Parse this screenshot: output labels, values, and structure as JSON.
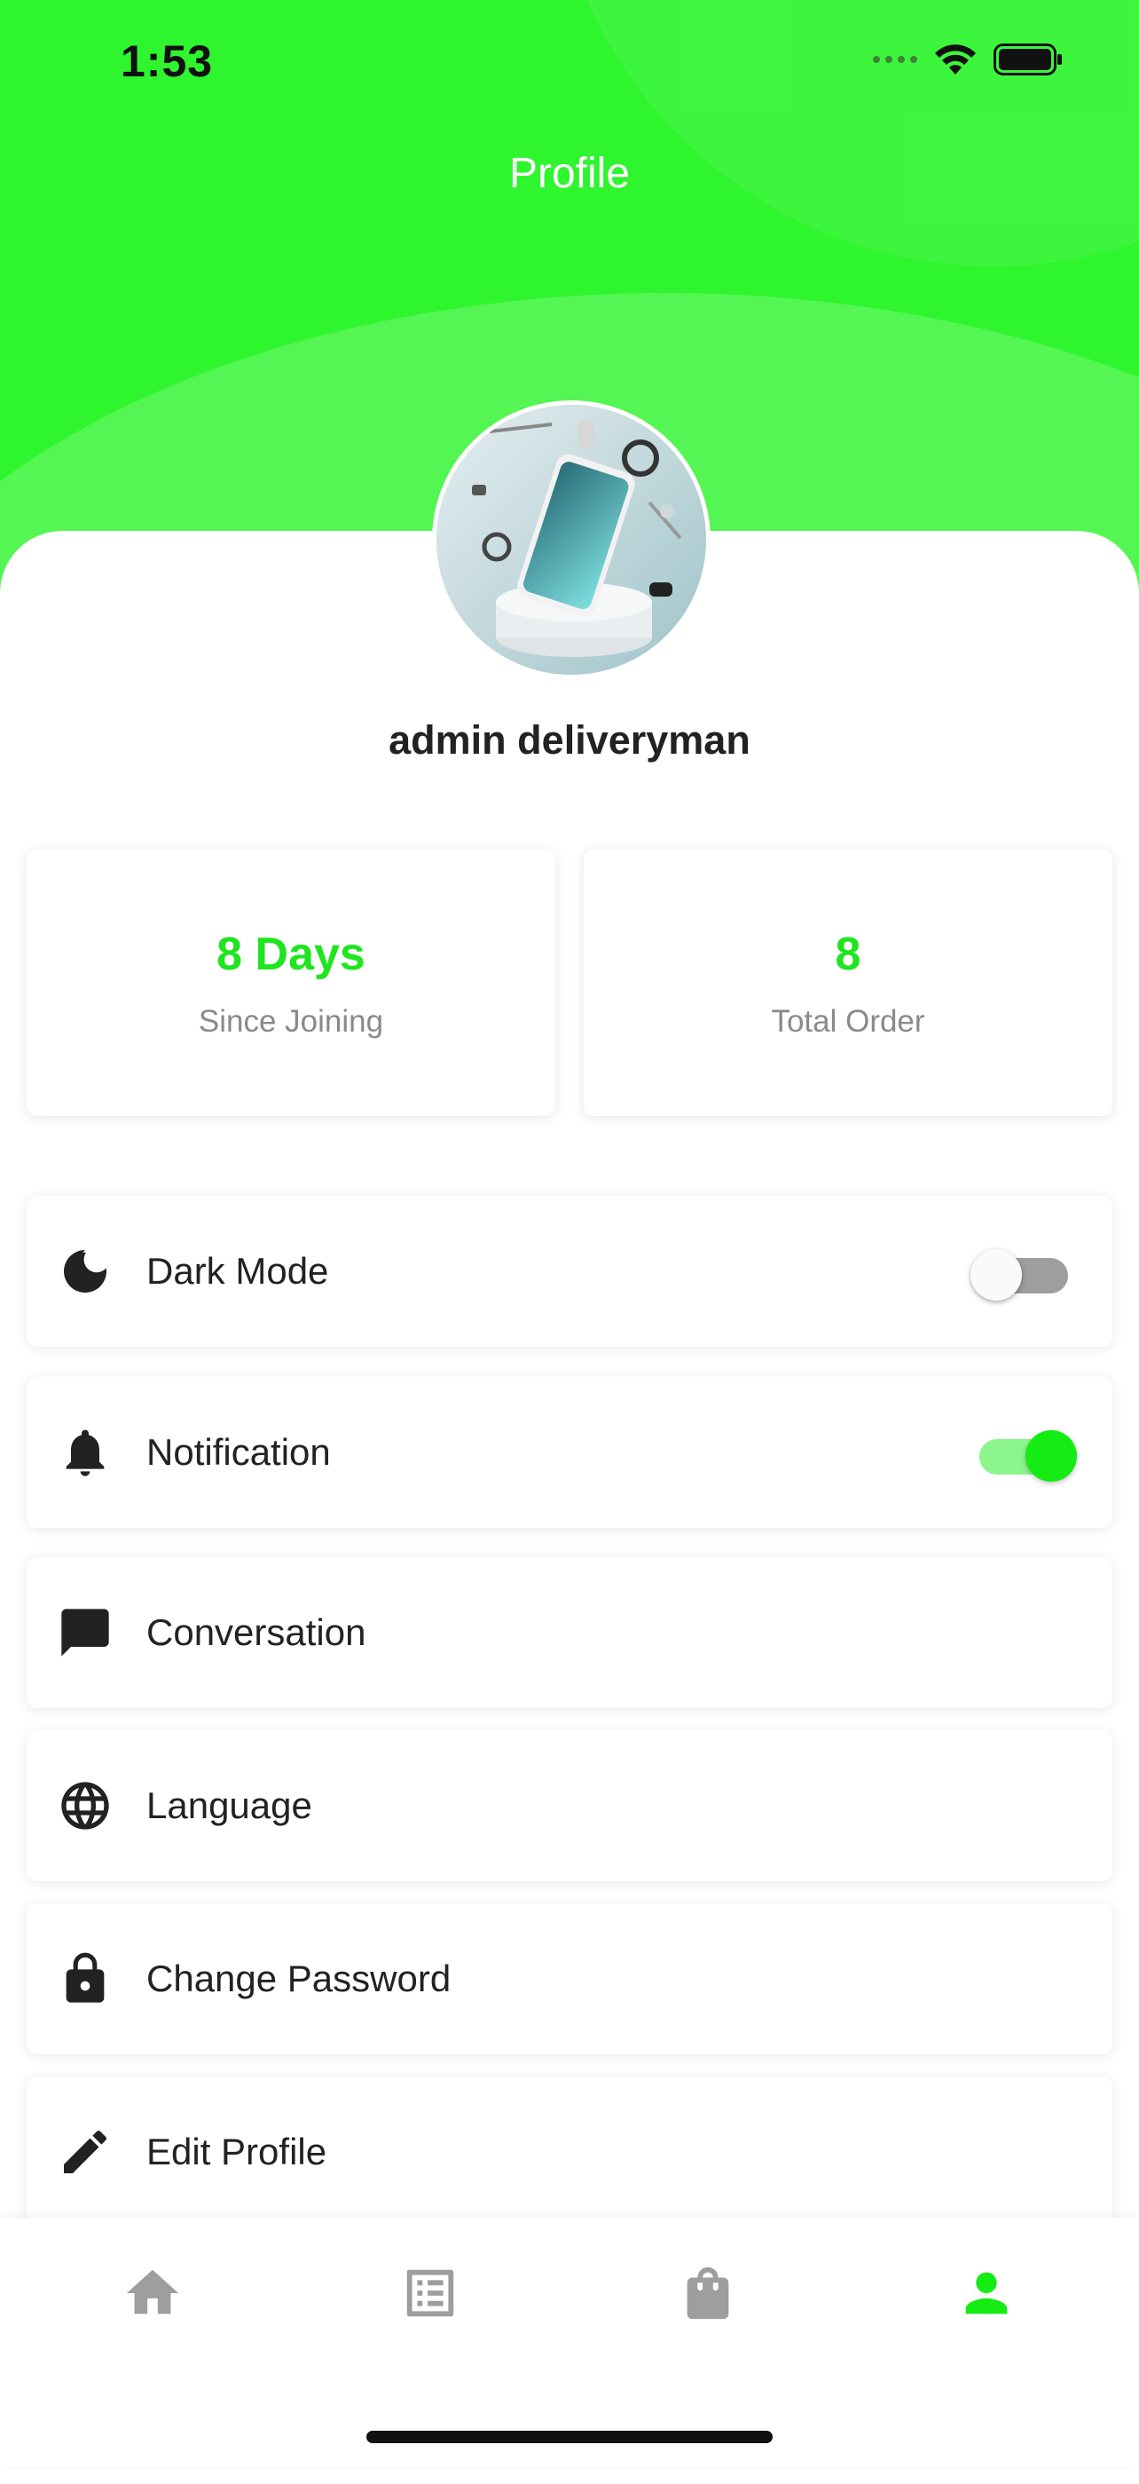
{
  "status_bar": {
    "time": "1:53"
  },
  "header": {
    "title": "Profile",
    "accent_color": "#2ef52e"
  },
  "profile": {
    "name": "admin deliveryman",
    "avatar": "product-promo-image"
  },
  "stats": [
    {
      "value": "8 Days",
      "label": "Since Joining"
    },
    {
      "value": "8",
      "label": "Total Order"
    }
  ],
  "menu": [
    {
      "icon": "moon-icon",
      "label": "Dark Mode",
      "toggle": false
    },
    {
      "icon": "bell-icon",
      "label": "Notification",
      "toggle": true
    },
    {
      "icon": "chat-icon",
      "label": "Conversation"
    },
    {
      "icon": "globe-icon",
      "label": "Language"
    },
    {
      "icon": "lock-icon",
      "label": "Change Password"
    },
    {
      "icon": "pencil-icon",
      "label": "Edit Profile"
    }
  ],
  "bottom_nav": [
    {
      "icon": "home-icon",
      "active": false
    },
    {
      "icon": "list-icon",
      "active": false
    },
    {
      "icon": "shopping-bag-icon",
      "active": false
    },
    {
      "icon": "person-icon",
      "active": true
    }
  ],
  "colors": {
    "active": "#14ec14",
    "inactive": "#9e9e9e"
  }
}
